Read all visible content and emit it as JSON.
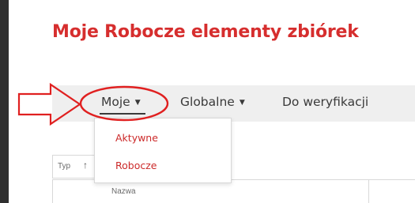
{
  "page": {
    "title": "Moje Robocze elementy zbiórek"
  },
  "tabs": [
    {
      "label": "Moje",
      "active": true,
      "has_dropdown": true
    },
    {
      "label": "Globalne",
      "active": false,
      "has_dropdown": true
    },
    {
      "label": "Do weryfikacji",
      "active": false,
      "has_dropdown": false
    }
  ],
  "dropdown": {
    "items": [
      {
        "label": "Aktywne"
      },
      {
        "label": "Robocze"
      }
    ]
  },
  "filter": {
    "label": "Typ",
    "sort_icon": "arrow-up-icon"
  },
  "table": {
    "columns": [
      {
        "label": "Nazwa"
      }
    ]
  },
  "colors": {
    "title": "#d62e2e",
    "annotation": "#e02020",
    "dropdown_item": "#cc2a2a",
    "tabbar_bg": "#efefef"
  },
  "icons": {
    "caret": "caret-down-icon",
    "pointer_arrow": "annotation-arrow-icon",
    "highlight": "annotation-ellipse"
  }
}
